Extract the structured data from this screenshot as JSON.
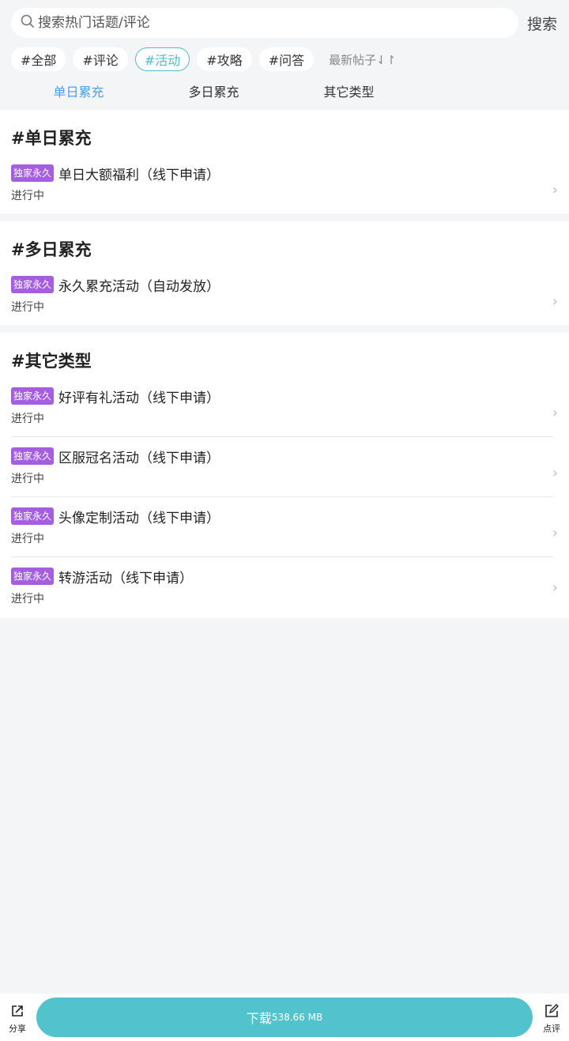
{
  "search": {
    "placeholder": "搜索热门话题/评论",
    "button_label": "搜索"
  },
  "tags": [
    {
      "label": "#全部"
    },
    {
      "label": "#评论"
    },
    {
      "label": "#活动"
    },
    {
      "label": "#攻略"
    },
    {
      "label": "#问答"
    }
  ],
  "sort_label": "最新帖子⇃↾",
  "tabs": [
    "单日累充",
    "多日累充",
    "其它类型"
  ],
  "sections": [
    {
      "title": "#单日累充",
      "items": [
        {
          "badge": "独家永久",
          "title": "单日大额福利（线下申请）",
          "status": "进行中"
        }
      ]
    },
    {
      "title": "#多日累充",
      "items": [
        {
          "badge": "独家永久",
          "title": "永久累充活动（自动发放）",
          "status": "进行中"
        }
      ]
    },
    {
      "title": "#其它类型",
      "items": [
        {
          "badge": "独家永久",
          "title": "好评有礼活动（线下申请）",
          "status": "进行中"
        },
        {
          "badge": "独家永久",
          "title": "区服冠名活动（线下申请）",
          "status": "进行中"
        },
        {
          "badge": "独家永久",
          "title": "头像定制活动（线下申请）",
          "status": "进行中"
        },
        {
          "badge": "独家永久",
          "title": "转游活动（线下申请）",
          "status": "进行中"
        }
      ]
    }
  ],
  "bottom": {
    "share_label": "分享",
    "download_label": "下载",
    "download_size": "538.66 MB",
    "review_label": "点评"
  },
  "colors": {
    "accent": "#4fbcc7",
    "tab_active": "#4d9ee8",
    "badge": "#a65ee0",
    "download": "#52c3cc"
  }
}
